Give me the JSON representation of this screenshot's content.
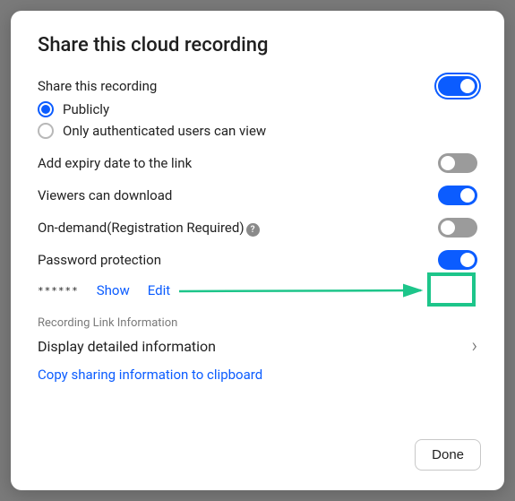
{
  "title": "Share this cloud recording",
  "shareRecording": {
    "label": "Share this recording",
    "value": true,
    "outlined": true,
    "options": {
      "public": "Publicly",
      "auth": "Only authenticated users can view"
    },
    "selected": "public"
  },
  "expiry": {
    "label": "Add expiry date to the link",
    "value": false
  },
  "download": {
    "label": "Viewers can download",
    "value": true
  },
  "onDemand": {
    "label": "On-demand(Registration Required)",
    "value": false
  },
  "password": {
    "label": "Password protection",
    "value": true,
    "masked": "******",
    "show": "Show",
    "edit": "Edit"
  },
  "linkInfo": {
    "section": "Recording Link Information",
    "disclosure": "Display detailed information",
    "copy": "Copy sharing information to clipboard"
  },
  "doneLabel": "Done"
}
